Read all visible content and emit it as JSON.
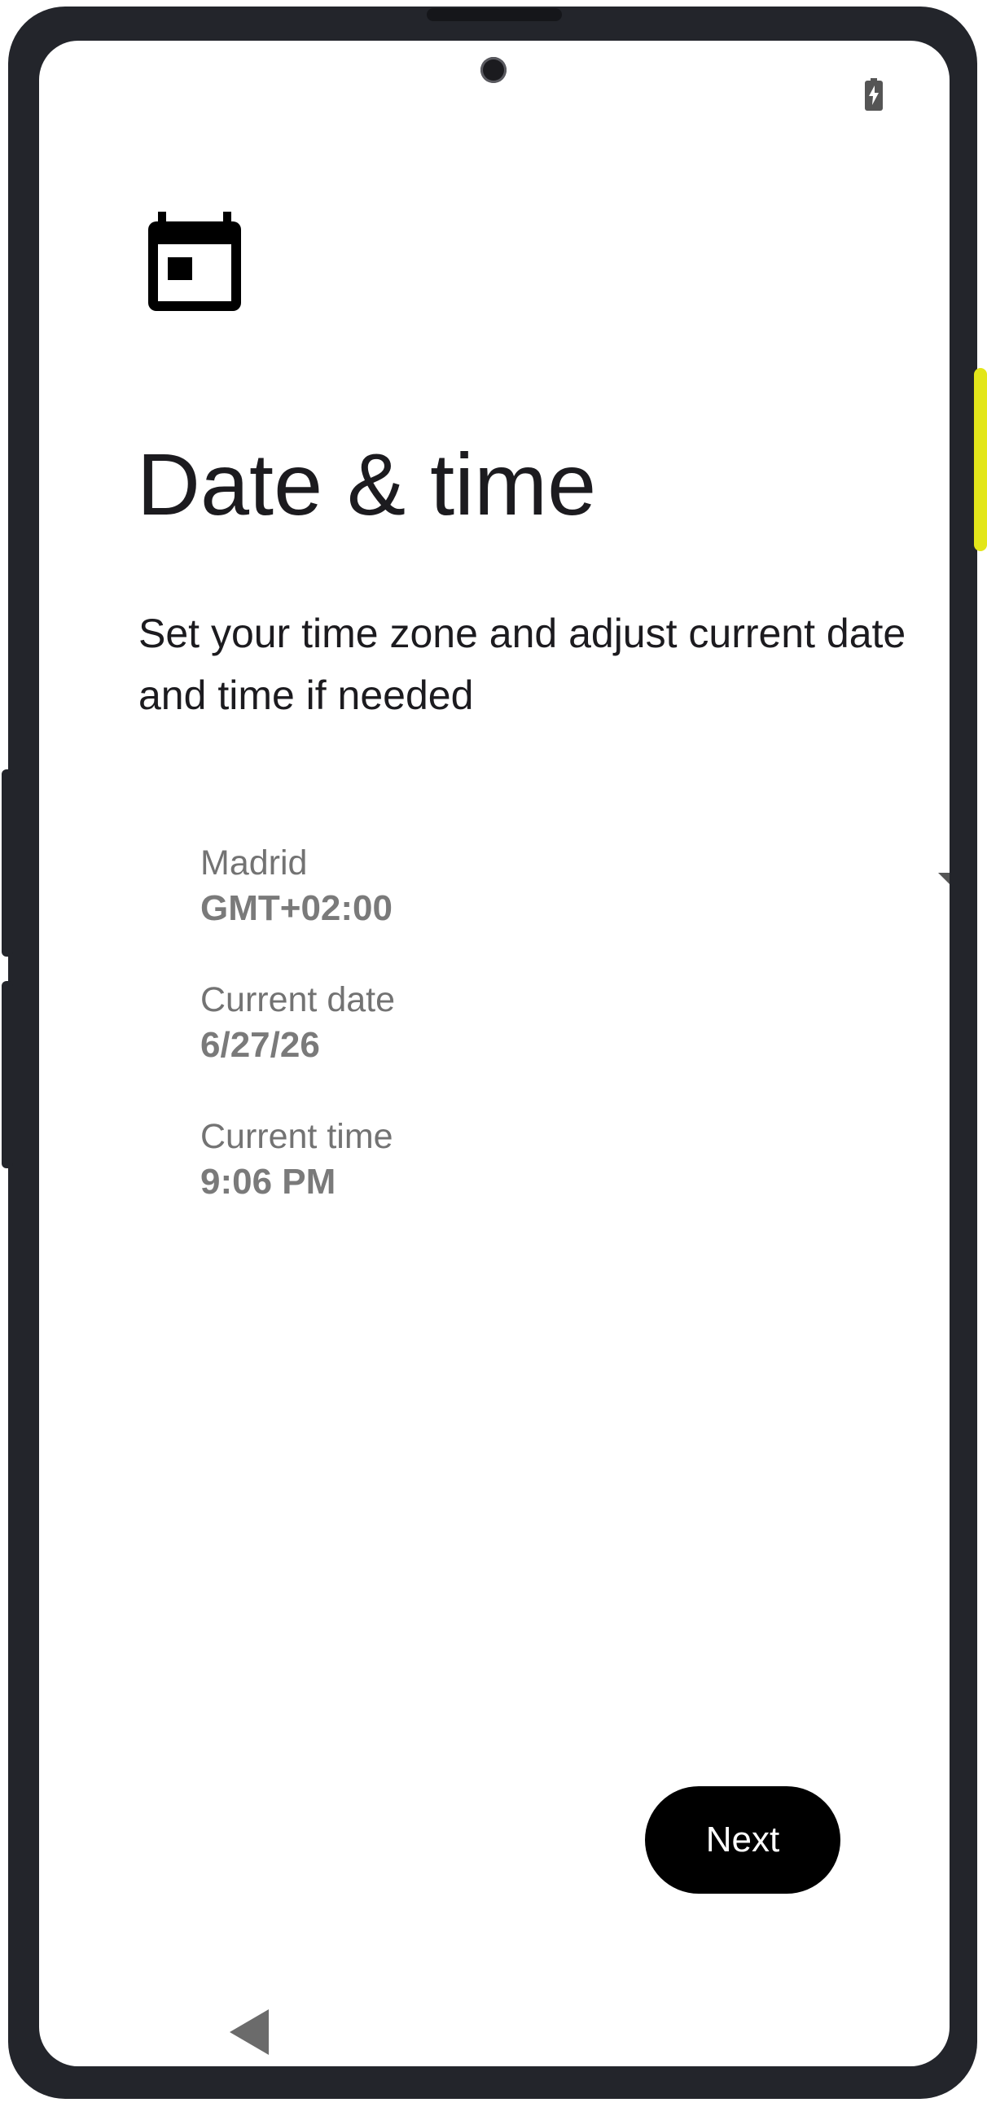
{
  "status_bar": {
    "battery_icon": "battery-charging-icon"
  },
  "header": {
    "icon": "calendar-icon",
    "title": "Date & time",
    "subtitle": "Set your time zone and adjust current date and time if needed"
  },
  "settings": {
    "timezone": {
      "label": "Madrid",
      "value": "GMT+02:00",
      "icon": "dropdown-arrow-icon"
    },
    "date": {
      "label": "Current date",
      "value": "6/27/26"
    },
    "time": {
      "label": "Current time",
      "value": "9:06 PM"
    }
  },
  "actions": {
    "next_label": "Next"
  },
  "navigation": {
    "back_icon": "back-triangle-icon"
  },
  "colors": {
    "device_frame": "#23252b",
    "power_button": "#e3e61a",
    "button_bg": "#000000",
    "button_text": "#ffffff",
    "secondary_text": "#737373"
  }
}
